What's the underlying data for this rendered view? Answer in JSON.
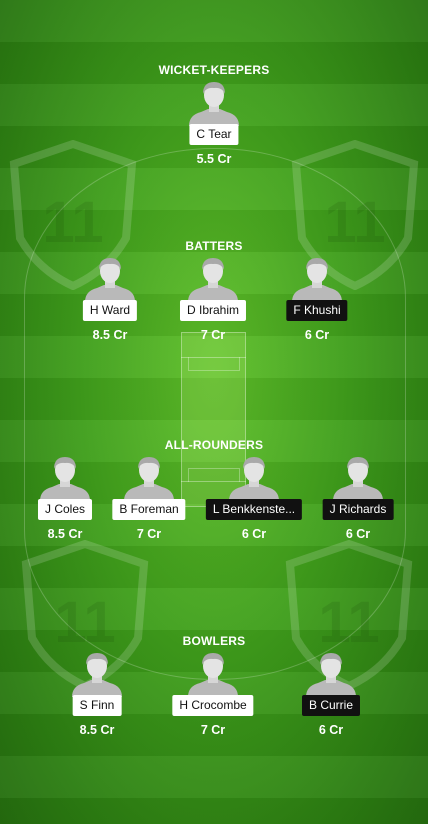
{
  "sections": {
    "wicket_keepers": "WICKET-KEEPERS",
    "batters": "BATTERS",
    "all_rounders": "ALL-ROUNDERS",
    "bowlers": "BOWLERS"
  },
  "watermark_text": "11",
  "players": {
    "wk": [
      {
        "name": "C Tear",
        "credit": "5.5 Cr",
        "team_style": "light"
      }
    ],
    "bat": [
      {
        "name": "H Ward",
        "credit": "8.5 Cr",
        "team_style": "light"
      },
      {
        "name": "D Ibrahim",
        "credit": "7 Cr",
        "team_style": "light"
      },
      {
        "name": "F Khushi",
        "credit": "6 Cr",
        "team_style": "dark"
      }
    ],
    "ar": [
      {
        "name": "J Coles",
        "credit": "8.5 Cr",
        "team_style": "light"
      },
      {
        "name": "B Foreman",
        "credit": "7 Cr",
        "team_style": "light"
      },
      {
        "name": "L Benkkenste...",
        "credit": "6 Cr",
        "team_style": "dark"
      },
      {
        "name": "J Richards",
        "credit": "6 Cr",
        "team_style": "dark"
      }
    ],
    "bowl": [
      {
        "name": "S Finn",
        "credit": "8.5 Cr",
        "team_style": "light"
      },
      {
        "name": "H Crocombe",
        "credit": "7 Cr",
        "team_style": "light"
      },
      {
        "name": "B Currie",
        "credit": "6 Cr",
        "team_style": "dark"
      }
    ]
  },
  "colors": {
    "field_green": "#3f9e1b",
    "light_tag": "#ffffff",
    "dark_tag": "#111111",
    "avatar_gray": "#b9b9b9"
  }
}
